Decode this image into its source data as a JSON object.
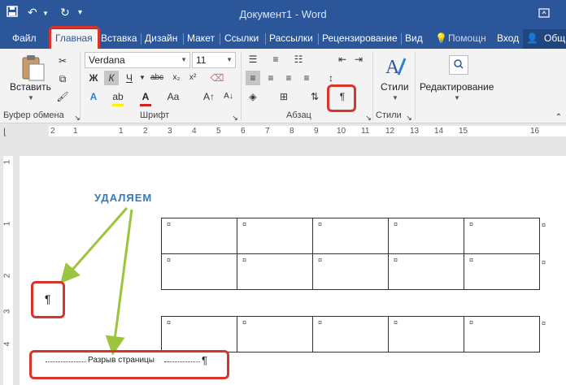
{
  "title_bar": {
    "document_title": "Документ1 - Word"
  },
  "tabs": [
    "Файл",
    "Главная",
    "Вставка",
    "Дизайн",
    "Макет",
    "Ссылки",
    "Рассылки",
    "Рецензирование",
    "Вид"
  ],
  "tell_me": "Помощн",
  "sign_in": "Вход",
  "share": "Общ",
  "clipboard": {
    "paste_label": "Вставить",
    "group_label": "Буфер обмена"
  },
  "font": {
    "family": "Verdana",
    "size": "11",
    "group_label": "Шрифт"
  },
  "paragraph": {
    "group_label": "Абзац",
    "pilcrow": "¶"
  },
  "styles": {
    "button_label": "Стили",
    "group_label": "Стили"
  },
  "editing": {
    "button_label": "Редактирование"
  },
  "ruler": {
    "h_numbers": [
      "2",
      "1",
      "1",
      "2",
      "3",
      "4",
      "5",
      "6",
      "7",
      "8",
      "9",
      "10",
      "11",
      "12",
      "13",
      "14",
      "15",
      "16"
    ],
    "v_numbers": [
      "1",
      "1",
      "2",
      "3",
      "4"
    ]
  },
  "document": {
    "annotation": "УДАЛЯЕМ",
    "pilcrow": "¶",
    "cell_mark": "¤",
    "page_break_text": "Разрыв страницы"
  },
  "colors": {
    "accent": "#2b579a",
    "highlight_box": "#d9342b",
    "arrow": "#9bc53d",
    "annotation_text": "#2e7bbf"
  }
}
